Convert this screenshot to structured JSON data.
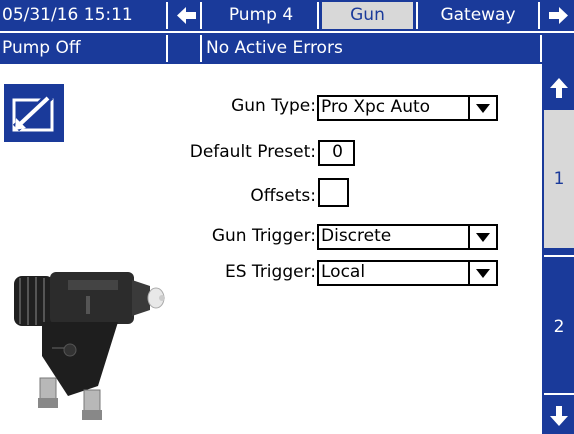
{
  "header": {
    "datetime": "05/31/16 15:11",
    "tabs": [
      {
        "label": "Pump 4"
      },
      {
        "label": "Gun"
      },
      {
        "label": "Gateway"
      }
    ]
  },
  "status": {
    "pump": "Pump Off",
    "errors": "No Active Errors"
  },
  "form": {
    "gun_type": {
      "label": "Gun Type:",
      "value": "Pro Xpc Auto"
    },
    "default_preset": {
      "label": "Default Preset:",
      "value": "0"
    },
    "offsets": {
      "label": "Offsets:"
    },
    "gun_trigger": {
      "label": "Gun Trigger:",
      "value": "Discrete"
    },
    "es_trigger": {
      "label": "ES Trigger:",
      "value": "Local"
    }
  },
  "pages": [
    {
      "label": "1"
    },
    {
      "label": "2"
    }
  ],
  "icons": {
    "edit": "edit-icon",
    "left": "arrow-left-icon",
    "right": "arrow-right-icon",
    "up": "arrow-up-icon",
    "down": "arrow-down-icon"
  },
  "colors": {
    "accent": "#1a3a9a",
    "active_tab": "#d8d8d8"
  }
}
